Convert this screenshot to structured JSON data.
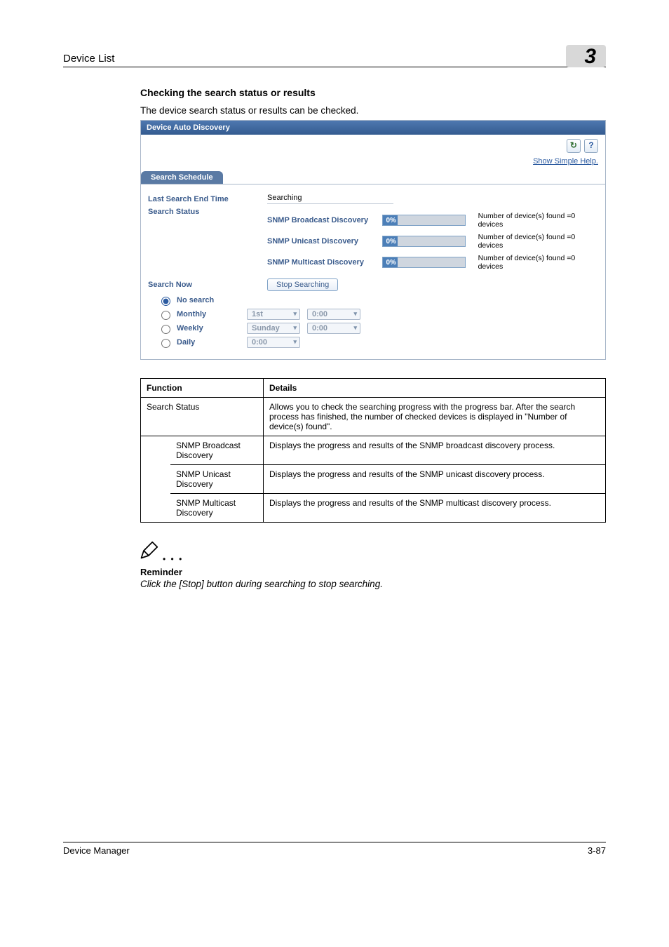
{
  "header": {
    "section": "Device List",
    "chapter_number": "3"
  },
  "body": {
    "heading": "Checking the search status or results",
    "intro": "The device search status or results can be checked."
  },
  "shot": {
    "title": "Device Auto Discovery",
    "refresh_icon_name": "↻",
    "help_icon_name": "?",
    "simple_help_link": "Show Simple Help.",
    "tab": "Search Schedule",
    "last_end_time_label": "Last Search End Time",
    "last_end_time_value": "Searching",
    "status_label": "Search Status",
    "methods": [
      {
        "name": "SNMP Broadcast Discovery",
        "pct": "0%",
        "found": "Number of device(s) found =0 devices"
      },
      {
        "name": "SNMP Unicast Discovery",
        "pct": "0%",
        "found": "Number of device(s) found =0 devices"
      },
      {
        "name": "SNMP Multicast Discovery",
        "pct": "0%",
        "found": "Number of device(s) found =0 devices"
      }
    ],
    "search_now_label": "Search Now",
    "stop_btn": "Stop Searching",
    "radios": {
      "no_search": "No search",
      "monthly": "Monthly",
      "weekly": "Weekly",
      "daily": "Daily"
    },
    "selects": {
      "monthly_day": "1st",
      "monthly_time": "0:00",
      "weekly_day": "Sunday",
      "weekly_time": "0:00",
      "daily_time": "0:00"
    }
  },
  "fd": {
    "col_function": "Function",
    "col_details": "Details",
    "rows": {
      "search_status": {
        "f": "Search Status",
        "d": "Allows you to check the searching progress with the progress bar. After the search process has finished, the number of checked devices is displayed in \"Number of device(s) found\"."
      },
      "broadcast": {
        "f": "SNMP Broadcast Discovery",
        "d": "Displays the progress and results of the SNMP broadcast discovery process."
      },
      "unicast": {
        "f": "SNMP Unicast Discovery",
        "d": "Displays the progress and results of the SNMP unicast discovery process."
      },
      "multicast": {
        "f": "SNMP Multicast Discovery",
        "d": "Displays the progress and results of the SNMP multicast discovery process."
      }
    }
  },
  "reminder": {
    "heading": "Reminder",
    "text": "Click the [Stop] button during searching to stop searching."
  },
  "footer": {
    "left": "Device Manager",
    "right": "3-87"
  }
}
